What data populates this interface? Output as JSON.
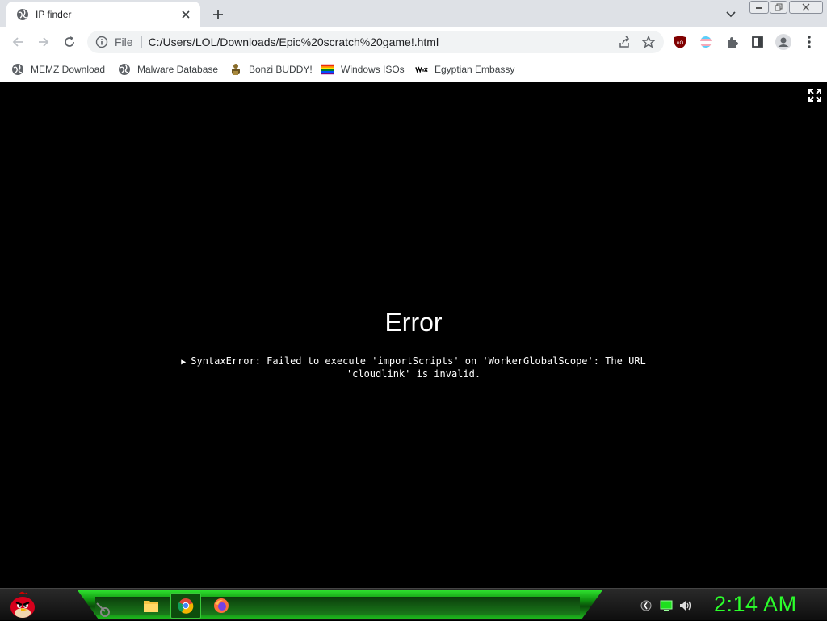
{
  "tab": {
    "title": "IP finder",
    "favicon": "globe-icon"
  },
  "toolbar": {
    "file_label": "File",
    "url": "C:/Users/LOL/Downloads/Epic%20scratch%20game!.html"
  },
  "bookmarks": [
    {
      "label": "MEMZ Download",
      "icon": "globe-icon"
    },
    {
      "label": "Malware Database",
      "icon": "globe-icon"
    },
    {
      "label": "Bonzi BUDDY!",
      "icon": "bonzi-icon"
    },
    {
      "label": "Windows ISOs",
      "icon": "rainbow-flag-icon"
    },
    {
      "label": "Egyptian Embassy",
      "icon": "wix-icon"
    }
  ],
  "page": {
    "error_title": "Error",
    "error_line1": "SyntaxError: Failed to execute 'importScripts' on 'WorkerGlobalScope': The URL",
    "error_line2": "'cloudlink' is invalid."
  },
  "taskbar": {
    "clock": "2:14 AM",
    "apps": [
      "file-explorer-icon",
      "chrome-icon",
      "firefox-icon"
    ]
  },
  "colors": {
    "accent_green": "#2bff2b",
    "tab_strip": "#dee1e6",
    "omnibox": "#f1f3f4"
  }
}
